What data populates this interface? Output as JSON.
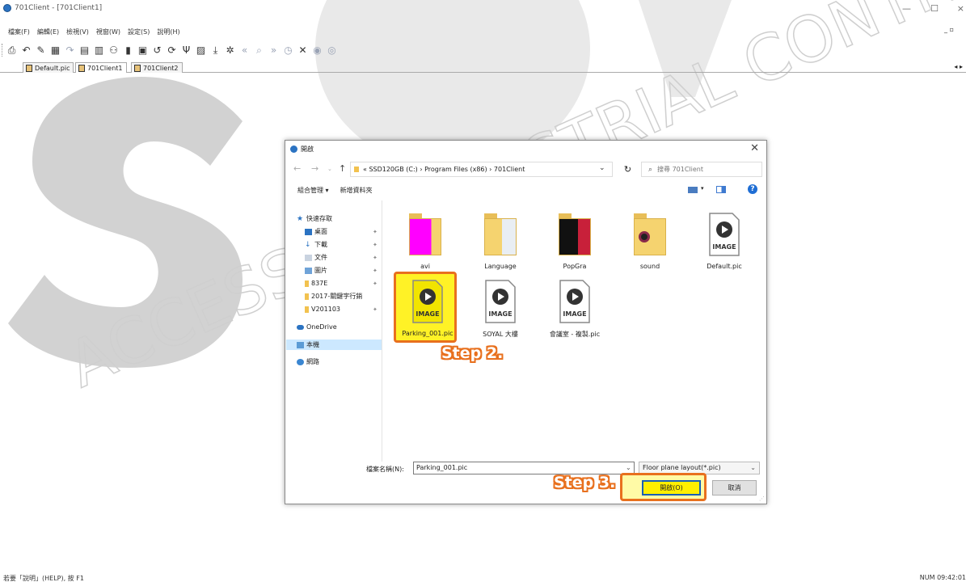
{
  "window": {
    "title": "701Client - [701Client1]",
    "minimize": "—",
    "maximize": "☐",
    "close": "×"
  },
  "menu": {
    "items": [
      "檔案(F)",
      "編輯(E)",
      "檢視(V)",
      "視窗(W)",
      "設定(S)",
      "說明(H)"
    ],
    "mdi_controls": "_ ▫"
  },
  "tabs": [
    {
      "label": "Default.pic"
    },
    {
      "label": "701Client1"
    },
    {
      "label": "701Client2"
    }
  ],
  "tab_nav": "◂ ▸",
  "status": {
    "left": "若要「說明」(HELP), 按 F1",
    "right": "NUM  09:42:01"
  },
  "watermark": {
    "logo_text": "SOYAL",
    "line_text": "ACCESS & INDUSTRIAL CONTROL"
  },
  "dialog": {
    "title": "開啟",
    "close": "✕",
    "breadcrumb": "«  SSD120GB (C:)  ›  Program Files (x86)  ›  701Client",
    "search_placeholder": "搜尋 701Client",
    "organize": "組合管理 ▾",
    "new_folder": "新增資料夾",
    "help": "?",
    "nav_pane": [
      {
        "label": "快速存取"
      },
      {
        "label": "桌面"
      },
      {
        "label": "下載"
      },
      {
        "label": "文件"
      },
      {
        "label": "圖片"
      },
      {
        "label": "837E"
      },
      {
        "label": "2017-關鍵字行銷"
      },
      {
        "label": "V201103"
      },
      {
        "label": "OneDrive"
      },
      {
        "label": "本機"
      },
      {
        "label": "網路"
      }
    ],
    "files": [
      {
        "name": "avi"
      },
      {
        "name": "Language"
      },
      {
        "name": "PopGra"
      },
      {
        "name": "sound"
      },
      {
        "name": "Default.pic"
      },
      {
        "name": "Parking_001.pic"
      },
      {
        "name": "SOYAL 大樓"
      },
      {
        "name": "會議室 - 複製.pic"
      }
    ],
    "image_badge": "IMAGE",
    "filename_label": "檔案名稱(N):",
    "filename_value": "Parking_001.pic",
    "filetype_value": "Floor plane layout(*.pic)",
    "open_label": "開啟(O)",
    "cancel_label": "取消"
  },
  "steps": {
    "step2": "Step 2.",
    "step3": "Step 3."
  },
  "colors": {
    "highlight": "#ffef00",
    "outline": "#e8701e",
    "selection": "#cce8ff",
    "accent": "#1a5fb4"
  }
}
